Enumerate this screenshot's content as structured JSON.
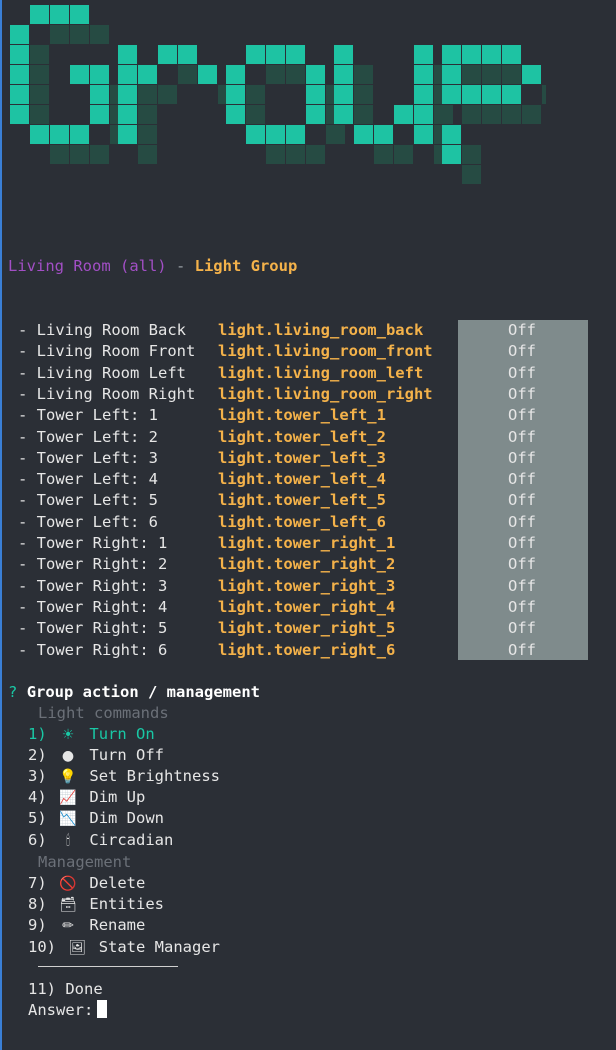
{
  "banner_text": "Group",
  "colors": {
    "banner_main": "#1ec3a3",
    "banner_shadow": "#264b43",
    "state_bg": "#7f8b8c",
    "accent_green": "#19c8a5"
  },
  "header": {
    "group_name": "Living Room (all)",
    "separator": " - ",
    "type": "Light Group"
  },
  "entities": [
    {
      "name": "Living Room Back",
      "entity_id": "light.living_room_back",
      "state": "Off"
    },
    {
      "name": "Living Room Front",
      "entity_id": "light.living_room_front",
      "state": "Off"
    },
    {
      "name": "Living Room Left",
      "entity_id": "light.living_room_left",
      "state": "Off"
    },
    {
      "name": "Living Room Right",
      "entity_id": "light.living_room_right",
      "state": "Off"
    },
    {
      "name": "Tower Left: 1",
      "entity_id": "light.tower_left_1",
      "state": "Off"
    },
    {
      "name": "Tower Left: 2",
      "entity_id": "light.tower_left_2",
      "state": "Off"
    },
    {
      "name": "Tower Left: 3",
      "entity_id": "light.tower_left_3",
      "state": "Off"
    },
    {
      "name": "Tower Left: 4",
      "entity_id": "light.tower_left_4",
      "state": "Off"
    },
    {
      "name": "Tower Left: 5",
      "entity_id": "light.tower_left_5",
      "state": "Off"
    },
    {
      "name": "Tower Left: 6",
      "entity_id": "light.tower_left_6",
      "state": "Off"
    },
    {
      "name": "Tower Right: 1",
      "entity_id": "light.tower_right_1",
      "state": "Off"
    },
    {
      "name": "Tower Right: 2",
      "entity_id": "light.tower_right_2",
      "state": "Off"
    },
    {
      "name": "Tower Right: 3",
      "entity_id": "light.tower_right_3",
      "state": "Off"
    },
    {
      "name": "Tower Right: 4",
      "entity_id": "light.tower_right_4",
      "state": "Off"
    },
    {
      "name": "Tower Right: 5",
      "entity_id": "light.tower_right_5",
      "state": "Off"
    },
    {
      "name": "Tower Right: 6",
      "entity_id": "light.tower_right_6",
      "state": "Off"
    }
  ],
  "prompt": {
    "marker": "?",
    "question": "Group action / management",
    "section_light": "Light commands",
    "section_management": "Management",
    "options": [
      {
        "num": "1)",
        "icon": "sun-icon",
        "glyph": "☀",
        "label": "Turn On",
        "highlighted": true
      },
      {
        "num": "2)",
        "icon": "moon-icon",
        "glyph": "●",
        "label": "Turn Off"
      },
      {
        "num": "3)",
        "icon": "lightbulb-icon",
        "glyph": "💡",
        "label": "Set Brightness"
      },
      {
        "num": "4)",
        "icon": "chart-up-icon",
        "glyph": "📈",
        "label": "Dim Up"
      },
      {
        "num": "5)",
        "icon": "chart-down-icon",
        "glyph": "📉",
        "label": "Dim Down"
      },
      {
        "num": "6)",
        "icon": "candle-icon",
        "glyph": "🕯",
        "label": "Circadian"
      },
      {
        "num": "7)",
        "icon": "no-entry-icon",
        "glyph": "🚫",
        "label": "Delete"
      },
      {
        "num": "8)",
        "icon": "card-box-icon",
        "glyph": "🗃",
        "label": "Entities"
      },
      {
        "num": "9)",
        "icon": "pencil-icon",
        "glyph": "✏",
        "label": "Rename"
      },
      {
        "num": "10)",
        "icon": "framed-picture-icon",
        "glyph": "🖼",
        "label": "State Manager"
      }
    ],
    "done": {
      "num": "11)",
      "label": "Done"
    },
    "answer_label": "Answer:"
  }
}
